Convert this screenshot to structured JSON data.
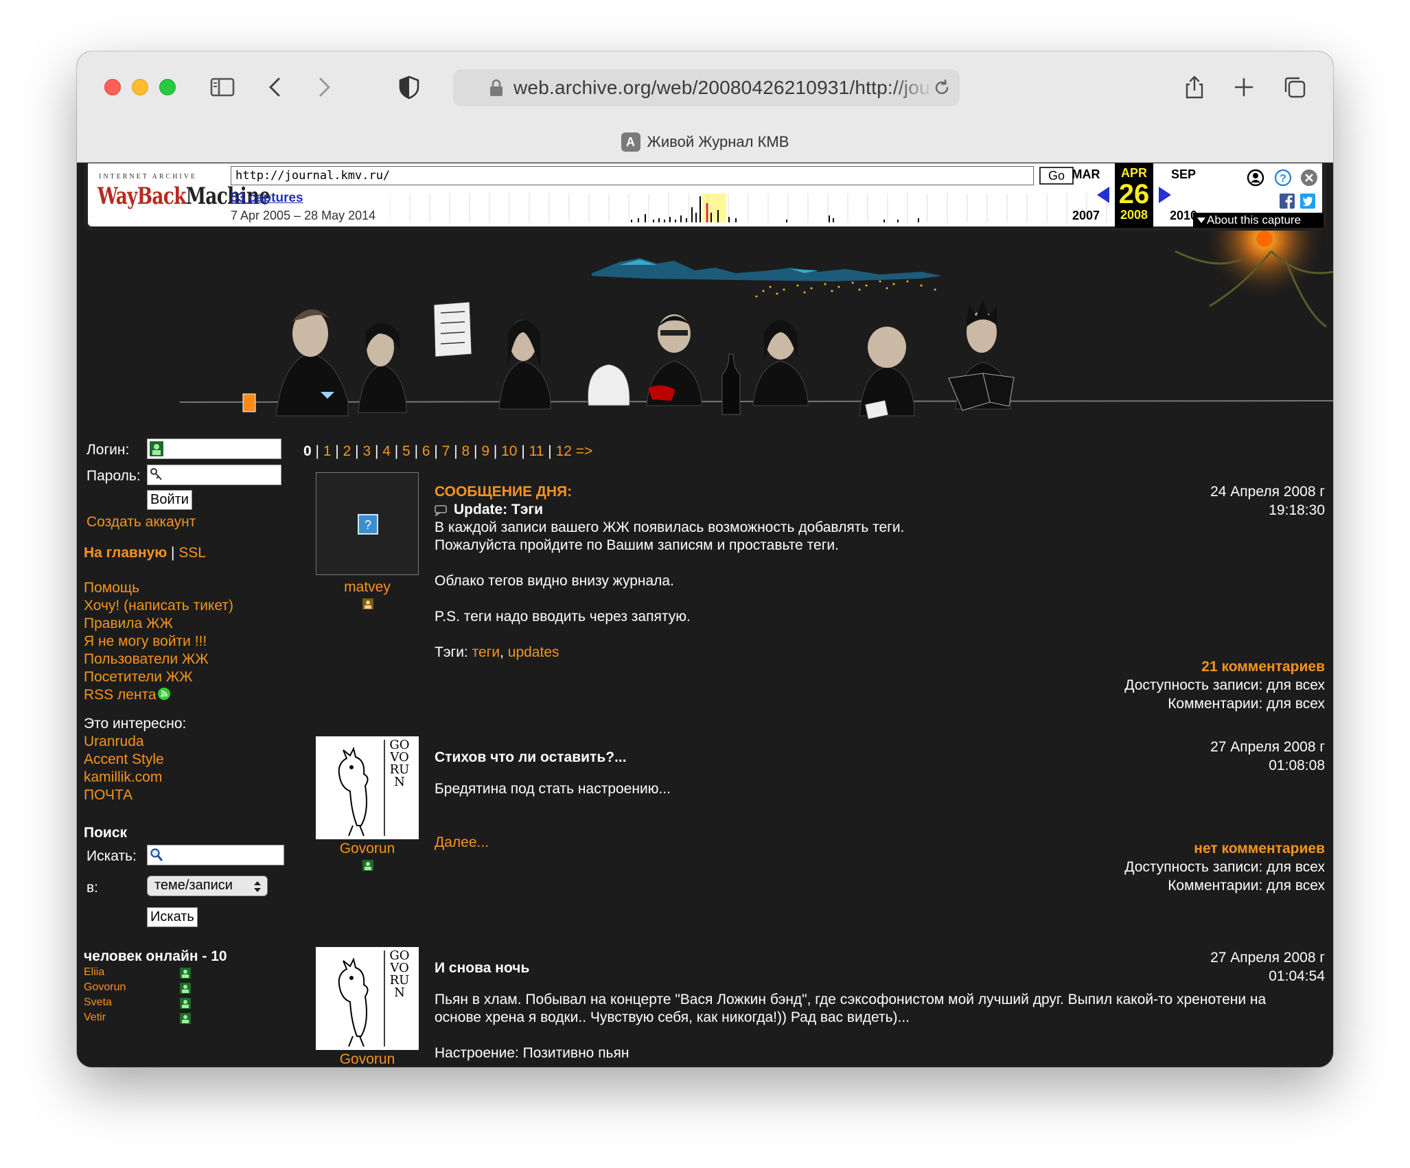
{
  "browser": {
    "url": "web.archive.org/web/20080426210931/http://jou",
    "tab_title": "Живой Журнал КМВ",
    "tab_favicon": "A"
  },
  "wayback": {
    "logo_top": "INTERNET ARCHIVE",
    "logo_a": "WayBack",
    "logo_b": "Machine",
    "url_value": "http://journal.kmv.ru/",
    "go_label": "Go",
    "captures": "53 captures",
    "range": "7 Apr 2005 – 28 May 2014",
    "prev_month": "MAR",
    "cur_month": "APR",
    "next_month": "SEP",
    "cur_day": "26",
    "prev_year": "2007",
    "cur_year": "2008",
    "next_year": "2010",
    "about": "About this capture"
  },
  "sidebar": {
    "login_label": "Логин:",
    "password_label": "Пароль:",
    "login_button": "Войти",
    "create_account": "Создать аккаунт",
    "home": "На главную",
    "sep": "|",
    "ssl": "SSL",
    "links": [
      "Помощь",
      "Хочу! (написать тикет)",
      "Правила ЖЖ",
      "Я не могу войти !!!",
      "Пользователи ЖЖ",
      "Посетители ЖЖ",
      "RSS лента"
    ],
    "interesting_label": "Это интересно:",
    "interesting": [
      "Uranruda",
      "Accent Style",
      "kamillik.com",
      "ПОЧТА"
    ],
    "search_heading": "Поиск",
    "search_label": "Искать:",
    "in_label": "в:",
    "search_scope": "теме/записи",
    "search_button": "Искать",
    "online_heading": "человек онлайн - 10",
    "online_users": [
      "Eliia",
      "Govorun",
      "Sveta",
      "Vetir"
    ]
  },
  "pager": {
    "current": "0",
    "pages": [
      "1",
      "2",
      "3",
      "4",
      "5",
      "6",
      "7",
      "8",
      "9",
      "10",
      "11",
      "12 =>"
    ]
  },
  "entries": [
    {
      "author": "matvey",
      "motd": "СООБЩЕНИЕ ДНЯ:",
      "title": "Update: Тэги",
      "date": "24 Апреля 2008 г",
      "time": "19:18:30",
      "p1": "В каждой записи вашего ЖЖ появилась возможность добавлять теги.",
      "p2": "Пожалуйста пройдите по Вашим записям и проставьте теги.",
      "p3": "Облако тегов видно внизу журнала.",
      "p4": "P.S. теги надо вводить через запятую.",
      "tags_label": "Тэги:",
      "tag1": "теги",
      "tag_sep": ",",
      "tag2": "updates",
      "comments": "21 комментариев",
      "access": "Доступность записи: для всех",
      "comments_access": "Комментарии: для всех"
    },
    {
      "author": "Govorun",
      "title": "Стихов что ли оставить?...",
      "date": "27 Апреля 2008 г",
      "time": "01:08:08",
      "p1": "Бредятина под стать настроению...",
      "more": "Далее...",
      "comments": "нет комментариев",
      "access": "Доступность записи: для всех",
      "comments_access": "Комментарии: для всех"
    },
    {
      "author": "Govorun",
      "title": "И снова ночь",
      "date": "27 Апреля 2008 г",
      "time": "01:04:54",
      "p1": "Пьян в хлам. Побывал на концерте \"Вася Ложкин бэнд\", где сэксофонистом мой лучший друг. Выпил какой-то хренотени на основе хрена я водки.. Чувствую себя, как никогда!)) Рад вас видеть)...",
      "mood": "Настроение: Позитивно пьян"
    }
  ],
  "avatar_text": "GOVORUN",
  "colors": {
    "accent": "#f7941d",
    "background": "#1c1c1c",
    "wayback_yellow": "#fcee21"
  }
}
